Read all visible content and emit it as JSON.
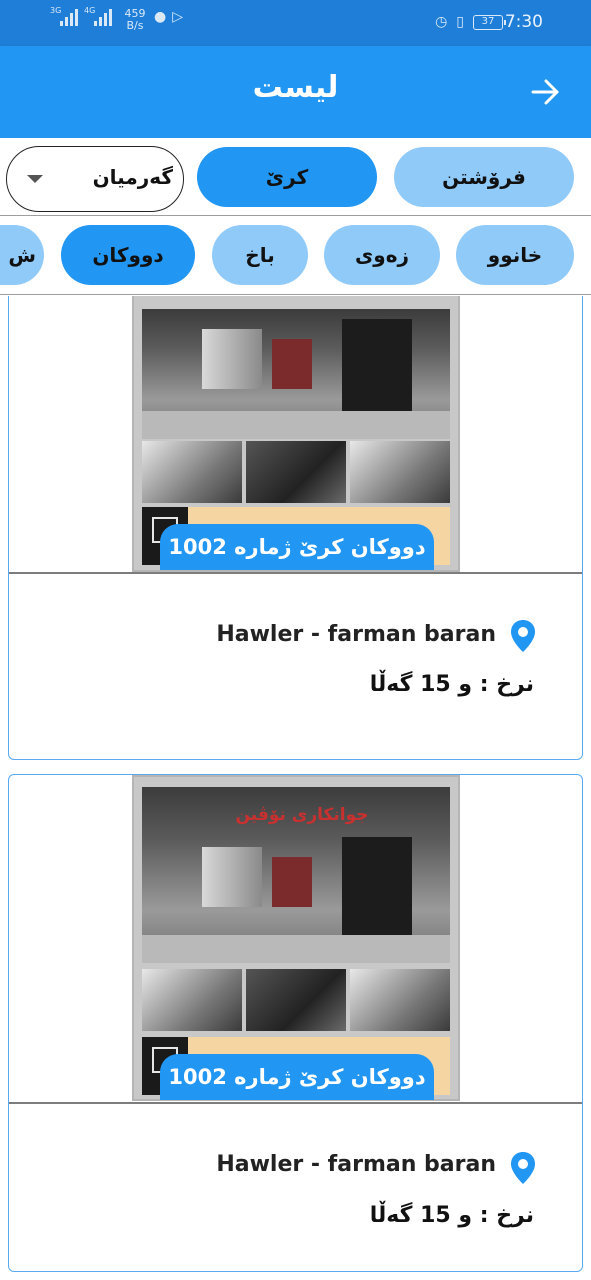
{
  "status_bar": {
    "signal1_label": "3G",
    "signal2_label": "4G",
    "net_speed": "459",
    "net_unit": "B/s",
    "battery": "37",
    "time": "7:30"
  },
  "app_bar": {
    "title": "لیست",
    "back_icon": "arrow-right-icon"
  },
  "filters": {
    "deal_types": [
      {
        "label": "فرۆشتن",
        "selected": false
      },
      {
        "label": "کرێ",
        "selected": true
      }
    ],
    "region": {
      "value": "گەرمیان"
    },
    "property_types": [
      {
        "label": "خانوو",
        "selected": false
      },
      {
        "label": "زەوی",
        "selected": false
      },
      {
        "label": "باخ",
        "selected": false
      },
      {
        "label": "دووکان",
        "selected": true
      },
      {
        "label": "ش",
        "selected": false
      }
    ]
  },
  "listings": [
    {
      "caption": "دووکان کرێ ژمارە 1002",
      "location": "Hawler - farman baran",
      "price_label": "نرخ :",
      "price_value": "و  15 گەڵا"
    },
    {
      "caption": "دووکان کرێ ژمارە 1002",
      "location": "Hawler - farman baran",
      "price_label": "نرخ :",
      "price_value": "و  15 گەڵا",
      "sign_text": "جوانکاری نۆڤین"
    }
  ],
  "colors": {
    "primary": "#2196f3",
    "primary_light": "#90caf9",
    "status_bar": "#1f7fd8"
  }
}
